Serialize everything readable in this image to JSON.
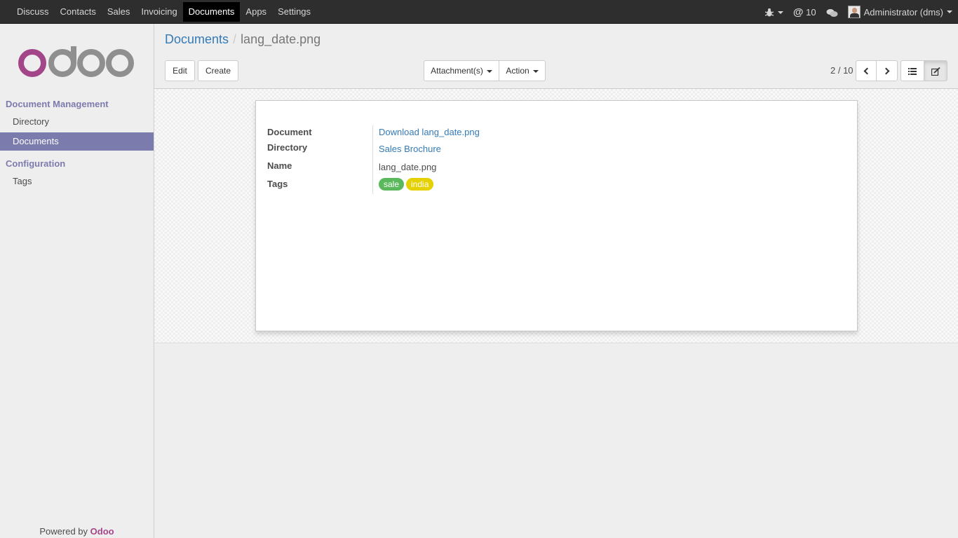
{
  "topbar": {
    "menu": [
      "Discuss",
      "Contacts",
      "Sales",
      "Invoicing",
      "Documents",
      "Apps",
      "Settings"
    ],
    "active_menu": "Documents",
    "messages_count": "10",
    "user": "Administrator (dms)"
  },
  "sidebar": {
    "section1": "Document Management",
    "items1": [
      "Directory",
      "Documents"
    ],
    "section2": "Configuration",
    "items2": [
      "Tags"
    ],
    "powered_prefix": "Powered by ",
    "powered_brand": "Odoo"
  },
  "breadcrumb": {
    "parent": "Documents",
    "separator": "/",
    "current": "lang_date.png"
  },
  "toolbar": {
    "edit": "Edit",
    "create": "Create",
    "attachments": "Attachment(s)",
    "action": "Action",
    "pager": "2 / 10"
  },
  "form": {
    "document_label": "Document",
    "document_value": "Download lang_date.png",
    "directory_label": "Directory",
    "directory_value": "Sales Brochure",
    "name_label": "Name",
    "name_value": "lang_date.png",
    "tags_label": "Tags",
    "tags": [
      {
        "label": "sale",
        "color": "#5cb85c"
      },
      {
        "label": "india",
        "color": "#e5d000"
      }
    ]
  },
  "colors": {
    "accent": "#7c7bad",
    "link": "#337ab7",
    "brand": "#a24689"
  }
}
